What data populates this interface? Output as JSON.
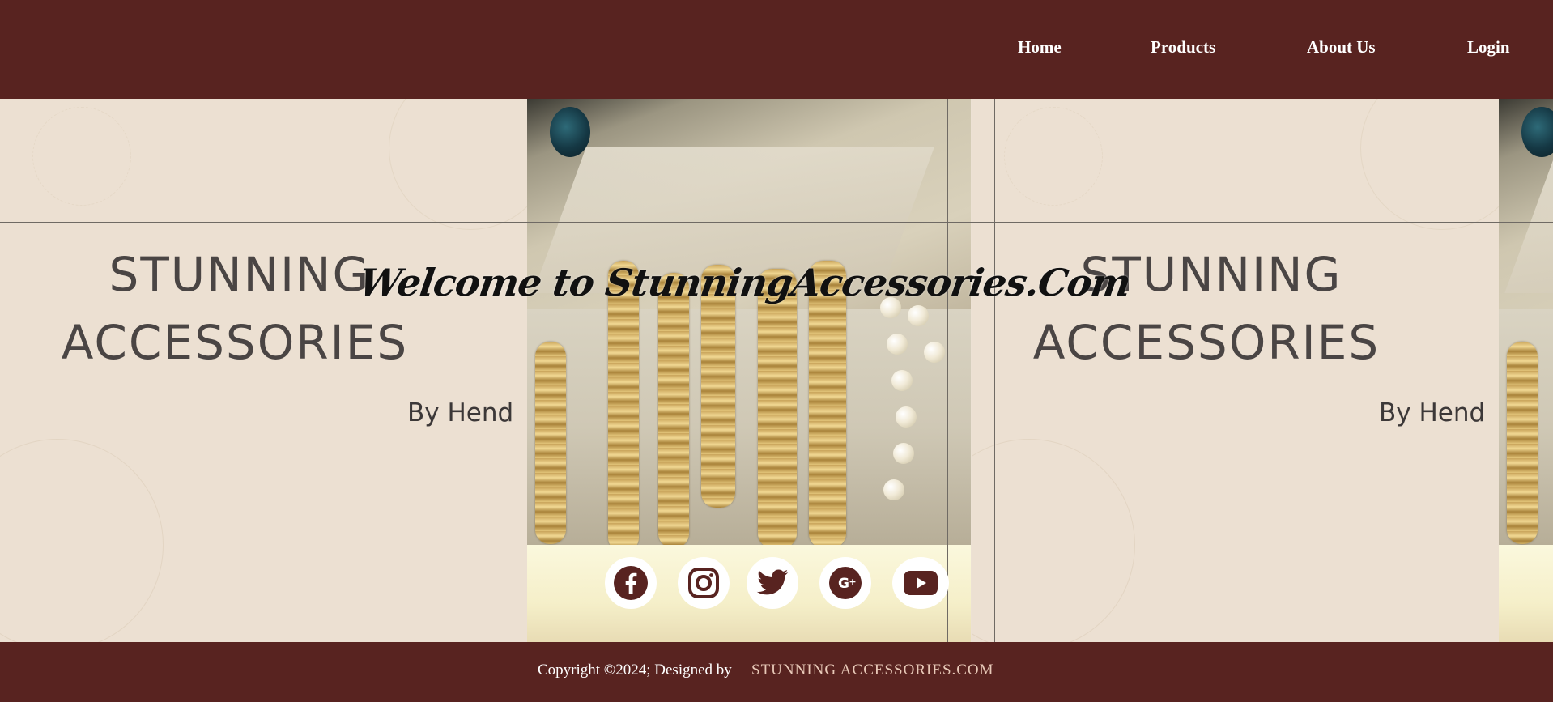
{
  "nav": {
    "links": [
      {
        "label": "Home"
      },
      {
        "label": "Products"
      },
      {
        "label": "About Us"
      },
      {
        "label": "Login"
      }
    ]
  },
  "hero": {
    "welcome": "Welcome to StunningAccessories.Com",
    "banner": {
      "line1": "STUNNING",
      "line2": "ACCESSORIES",
      "byline": "By Hend"
    }
  },
  "social": [
    {
      "name": "facebook",
      "icon": "facebook-icon"
    },
    {
      "name": "instagram",
      "icon": "instagram-icon"
    },
    {
      "name": "twitter",
      "icon": "twitter-icon"
    },
    {
      "name": "google-plus",
      "icon": "google-plus-icon"
    },
    {
      "name": "youtube",
      "icon": "youtube-icon"
    }
  ],
  "footer": {
    "copyright": "Copyright ©2024; Designed by",
    "site": "STUNNING ACCESSORIES.COM"
  },
  "colors": {
    "primary": "#582320",
    "banner_bg": "#ece0d2",
    "footer_link": "#e8c9b8",
    "icon": "#582320"
  }
}
